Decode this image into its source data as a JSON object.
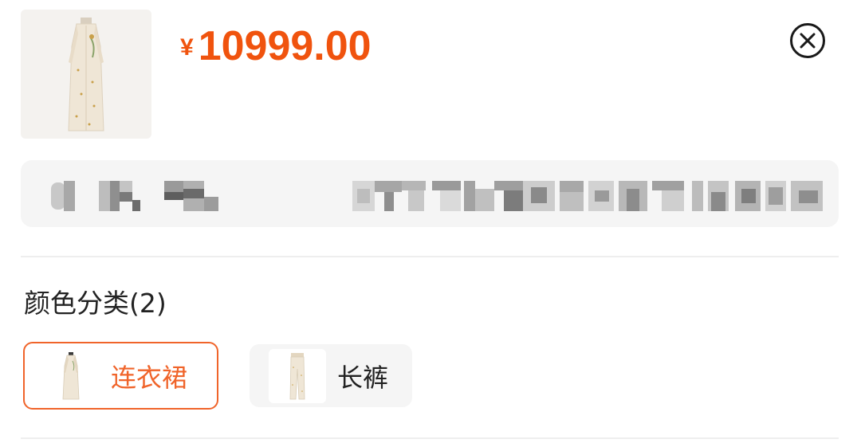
{
  "product": {
    "thumbnail_icon": "dress-image",
    "price_symbol": "¥",
    "price": "10999.00"
  },
  "close_icon": "close-circle-icon",
  "address": {
    "redacted": true,
    "icon": "location-icon"
  },
  "options": {
    "title": "颜色分类(2)",
    "items": [
      {
        "label": "连衣裙",
        "image_icon": "dress-image",
        "selected": true
      },
      {
        "label": "长裤",
        "image_icon": "pants-image",
        "selected": false
      }
    ]
  },
  "colors": {
    "accent": "#f0530e",
    "selected_border": "#f0642a",
    "panel_bg": "#f5f5f5"
  }
}
